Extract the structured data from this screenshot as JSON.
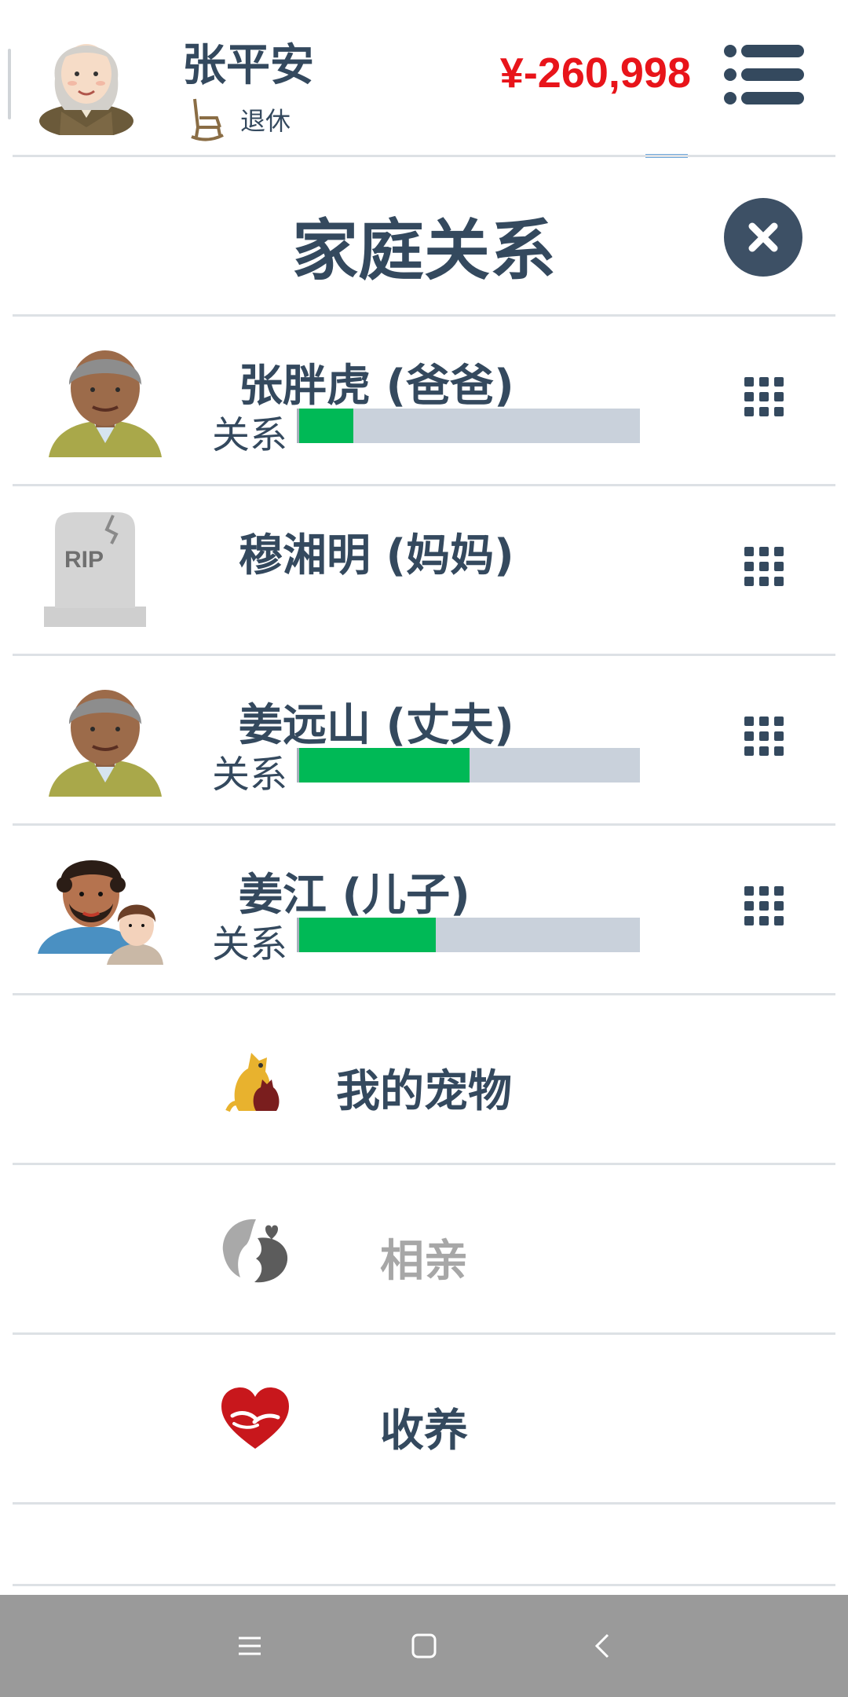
{
  "header": {
    "name": "张平安",
    "status": "退休",
    "money": "¥-260,998"
  },
  "panel": {
    "title": "家庭关系"
  },
  "members": [
    {
      "name": "张胖虎 (爸爸)",
      "relation_label": "关系",
      "relation_level": 0.16,
      "avatar": "elderly-man-avatar"
    },
    {
      "name": "穆湘明 (妈妈)",
      "avatar": "rip-tombstone"
    },
    {
      "name": "姜远山 (丈夫)",
      "relation_label": "关系",
      "relation_level": 0.5,
      "avatar": "elderly-man-avatar"
    },
    {
      "name": "姜江 (儿子)",
      "relation_label": "关系",
      "relation_level": 0.4,
      "avatar": "son-with-wife-avatar"
    }
  ],
  "options": [
    {
      "label": "我的宠物",
      "icon": "pets-icon",
      "disabled": false
    },
    {
      "label": "相亲",
      "icon": "blind-date-icon",
      "disabled": true
    },
    {
      "label": "收养",
      "icon": "adoption-heart-icon",
      "disabled": false
    }
  ],
  "colors": {
    "text": "#34495e",
    "money": "#e8141a",
    "bar_fill": "#00b956",
    "bar_bg": "#c9d1db",
    "disabled_text": "#a7a7a7"
  },
  "navbar": {
    "icons": [
      "menu-nav-icon",
      "home-nav-icon",
      "back-nav-icon"
    ]
  }
}
